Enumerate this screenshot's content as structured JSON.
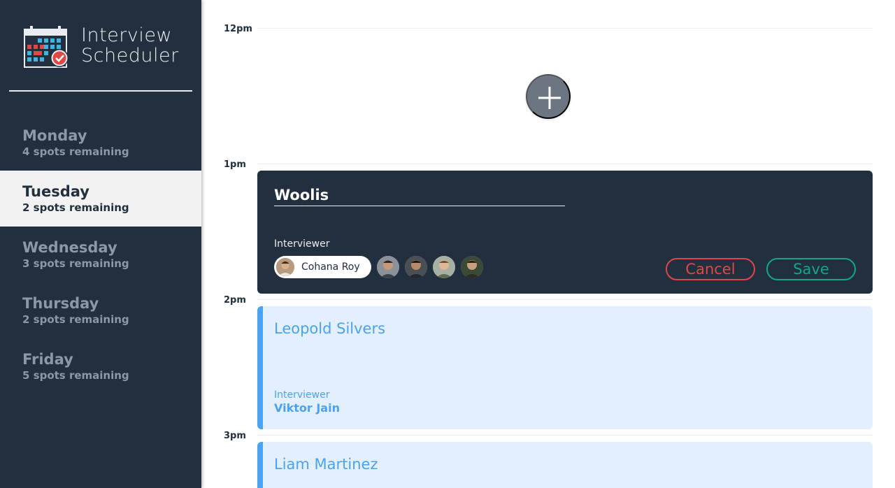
{
  "brand": {
    "line1": "Interview",
    "line2": "Scheduler",
    "icon": "calendar-check-icon"
  },
  "days": [
    {
      "name": "Monday",
      "spots": "4 spots remaining",
      "selected": false
    },
    {
      "name": "Tuesday",
      "spots": "2 spots remaining",
      "selected": true
    },
    {
      "name": "Wednesday",
      "spots": "3 spots remaining",
      "selected": false
    },
    {
      "name": "Thursday",
      "spots": "2 spots remaining",
      "selected": false
    },
    {
      "name": "Friday",
      "spots": "5 spots remaining",
      "selected": false
    }
  ],
  "times": [
    "12pm",
    "1pm",
    "2pm",
    "3pm"
  ],
  "add_button": {
    "icon": "plus-icon"
  },
  "form": {
    "student_value": "Woolis",
    "interviewer_heading": "Interviewer",
    "selected_interviewer": "Cohana Roy",
    "cancel_label": "Cancel",
    "save_label": "Save"
  },
  "appointments": [
    {
      "student": "Leopold Silvers",
      "interviewer_heading": "Interviewer",
      "interviewer": "Viktor Jain"
    },
    {
      "student": "Liam Martinez"
    }
  ],
  "colors": {
    "sidebar": "#222f3e",
    "selected_day": "#f2f2f2",
    "cancel": "#e04848",
    "save": "#10a985",
    "booked_bg": "#e3effd",
    "booked_accent": "#4aa3f0"
  }
}
